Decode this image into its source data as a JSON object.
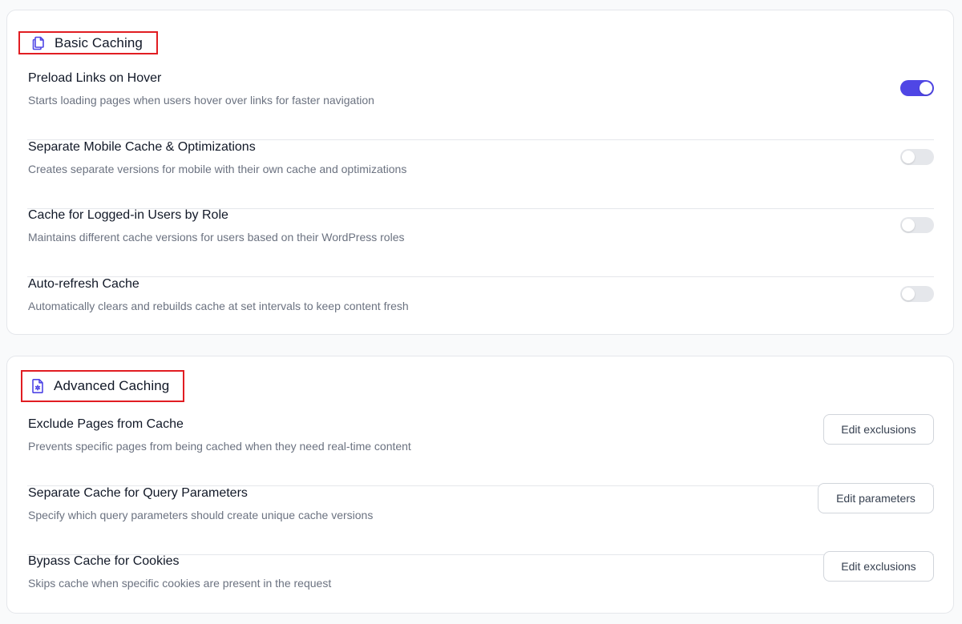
{
  "colors": {
    "accent": "#4f46e5",
    "highlight_border": "#e11d22",
    "toggle_off": "#e5e7eb"
  },
  "basic": {
    "title": "Basic Caching",
    "icon": "copy-files-icon",
    "rows": [
      {
        "title": "Preload Links on Hover",
        "desc": "Starts loading pages when users hover over links for faster navigation",
        "enabled": true
      },
      {
        "title": "Separate Mobile Cache & Optimizations",
        "desc": "Creates separate versions for mobile with their own cache and optimizations",
        "enabled": false
      },
      {
        "title": "Cache for Logged-in Users by Role",
        "desc": "Maintains different cache versions for users based on their WordPress roles",
        "enabled": false
      },
      {
        "title": "Auto-refresh Cache",
        "desc": "Automatically clears and rebuilds cache at set intervals to keep content fresh",
        "enabled": false
      }
    ]
  },
  "advanced": {
    "title": "Advanced Caching",
    "icon": "file-settings-icon",
    "rows": [
      {
        "title": "Exclude Pages from Cache",
        "desc": "Prevents specific pages from being cached when they need real-time content",
        "button": "Edit exclusions"
      },
      {
        "title": "Separate Cache for Query Parameters",
        "desc": "Specify which query parameters should create unique cache versions",
        "button": "Edit parameters"
      },
      {
        "title": "Bypass Cache for Cookies",
        "desc": "Skips cache when specific cookies are present in the request",
        "button": "Edit exclusions"
      }
    ]
  }
}
